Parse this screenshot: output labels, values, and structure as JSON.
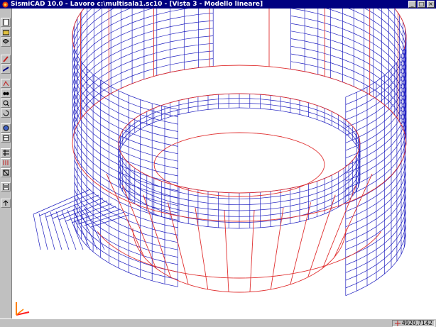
{
  "window": {
    "title": "SismiCAD 10.0 - Lavoro c:\\multisala1.sc10 - [Vista 3 - Modello lineare]",
    "minimize_symbol": "_",
    "maximize_symbol": "□",
    "close_symbol": "×"
  },
  "toolbar": {
    "tools": [
      "new-file-icon",
      "open-file-icon",
      "layers-icon",
      "pencil-icon",
      "measure-icon",
      "node-icon",
      "binoculars-icon",
      "zoom-icon",
      "rotate-view-icon",
      "analysis-icon",
      "section-icon",
      "grid-icon",
      "load-icon",
      "frame-icon",
      "report-icon",
      "export-icon"
    ]
  },
  "status": {
    "coordinates": "4920,7142"
  },
  "colors": {
    "mesh": "#2020c0",
    "frame": "#e03030",
    "titlebar": "#000080",
    "chrome": "#c0c0c0"
  }
}
